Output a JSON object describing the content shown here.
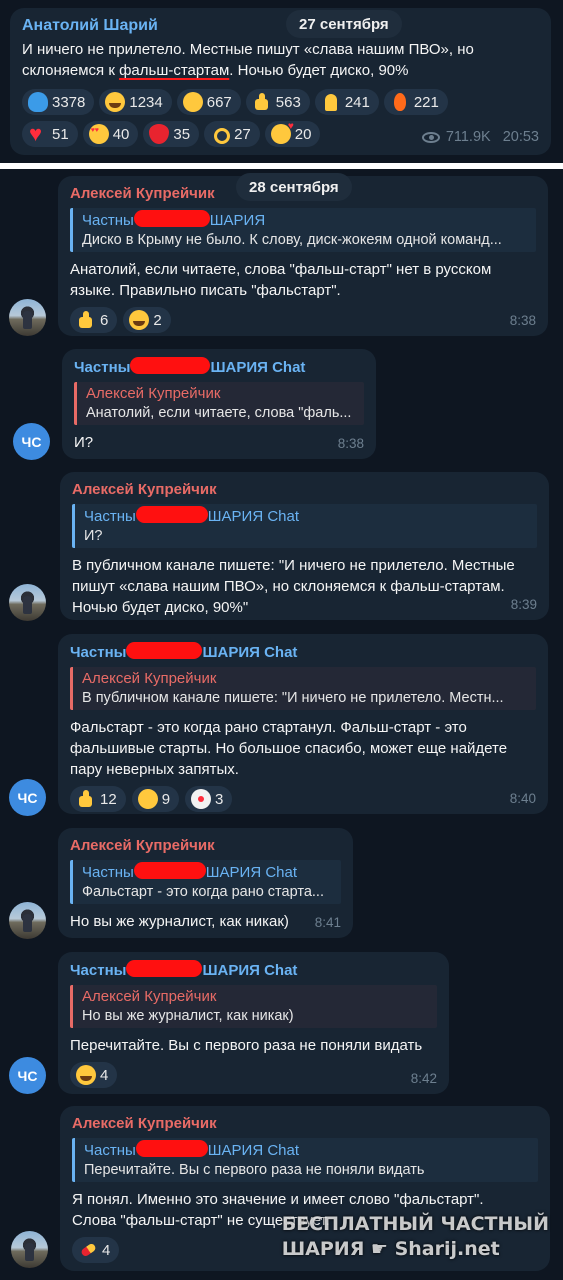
{
  "post": {
    "author": "Анатолий Шарий",
    "date": "27 сентября",
    "text_before": "И ничего не прилетело. Местные пишут «слава нашим ПВО», но склоняемся к ",
    "text_highlight": "фальш-стартам",
    "text_after": ". Ночью будет диско, 90%",
    "reactions": [
      {
        "icon": "whale-emoji",
        "count": "3378"
      },
      {
        "icon": "grinning-face-emoji",
        "count": "1234"
      },
      {
        "icon": "mind-blown-emoji",
        "count": "667"
      },
      {
        "icon": "thumbs-up-emoji",
        "count": "563"
      },
      {
        "icon": "folded-hands-emoji",
        "count": "241"
      },
      {
        "icon": "fire-emoji",
        "count": "221"
      },
      {
        "icon": "red-heart-emoji",
        "count": "51"
      },
      {
        "icon": "heart-eyes-emoji",
        "count": "40"
      },
      {
        "icon": "strawberry-emoji",
        "count": "35"
      },
      {
        "icon": "ok-hand-emoji",
        "count": "27"
      },
      {
        "icon": "kissing-heart-emoji",
        "count": "20"
      }
    ],
    "views": "711.9K",
    "time": "20:53"
  },
  "chat": {
    "date": "28 сентября",
    "messages": [
      {
        "sender": "Алексей Купрейчик",
        "reply_name_a": "Частны",
        "reply_name_b": "ШАРИЯ",
        "reply_text": "Диско в Крыму не было. К слову, диск-жокеям одной команд...",
        "text": "Анатолий, если читаете, слова \"фальш-старт\" нет в русском языке. Правильно писать \"фальстарт\".",
        "reactions": [
          {
            "icon": "thumbs-up-emoji",
            "count": "6"
          },
          {
            "icon": "grinning-face-emoji",
            "count": "2"
          }
        ],
        "time": "8:38"
      },
      {
        "sender_a": "Частны",
        "sender_b": "ШАРИЯ Chat",
        "reply_name": "Алексей Купрейчик",
        "reply_text": "Анатолий, если читаете, слова \"фаль...",
        "text": "И?",
        "time": "8:38",
        "avatar": "ЧС"
      },
      {
        "sender": "Алексей Купрейчик",
        "reply_name_a": "Частны",
        "reply_name_b": "ШАРИЯ Chat",
        "reply_text": "И?",
        "text": "В публичном канале пишете: \"И ничего не прилетело. Местные пишут «слава нашим ПВО», но склоняемся к фальш-стартам. Ночью будет диско, 90%\"",
        "time": "8:39"
      },
      {
        "sender_a": "Частны",
        "sender_b": "ШАРИЯ Chat",
        "reply_name": "Алексей Купрейчик",
        "reply_text": "В публичном канале пишете: \"И ничего не прилетело. Местн...",
        "text": "Фальстарт - это когда рано стартанул. Фальш-старт - это фальшивые старты. Но большое спасибо, может еще найдете пару неверных запятых.",
        "reactions": [
          {
            "icon": "thumbs-up-emoji",
            "count": "12"
          },
          {
            "icon": "rofl-emoji",
            "count": "9"
          },
          {
            "icon": "clown-emoji",
            "count": "3"
          }
        ],
        "time": "8:40",
        "avatar": "ЧС"
      },
      {
        "sender": "Алексей Купрейчик",
        "reply_name_a": "Частны",
        "reply_name_b": "ШАРИЯ Chat",
        "reply_text": "Фальстарт - это когда рано старта...",
        "text": "Но вы же журналист, как никак)",
        "time": "8:41"
      },
      {
        "sender_a": "Частны",
        "sender_b": "ШАРИЯ Chat",
        "reply_name": "Алексей Купрейчик",
        "reply_text": "Но вы же журналист, как никак)",
        "text": "Перечитайте. Вы с первого раза не поняли видать",
        "reactions": [
          {
            "icon": "grinning-face-emoji",
            "count": "4"
          }
        ],
        "time": "8:42",
        "avatar": "ЧС"
      },
      {
        "sender": "Алексей Купрейчик",
        "reply_name_a": "Частны",
        "reply_name_b": "ШАРИЯ Chat",
        "reply_text": "Перечитайте. Вы с первого раза не поняли видать",
        "text": "Я понял. Именно это значение и имеет слово \"фальстарт\". Слова \"фальш-старт\" не существует.",
        "reactions": [
          {
            "icon": "pill-emoji",
            "count": "4"
          }
        ],
        "time": ""
      }
    ]
  },
  "watermark": {
    "line1": "БЕСПЛАТНЫЙ ЧАСТНЫЙ",
    "line2": "ШАРИЯ ☛ Sharij.net"
  }
}
